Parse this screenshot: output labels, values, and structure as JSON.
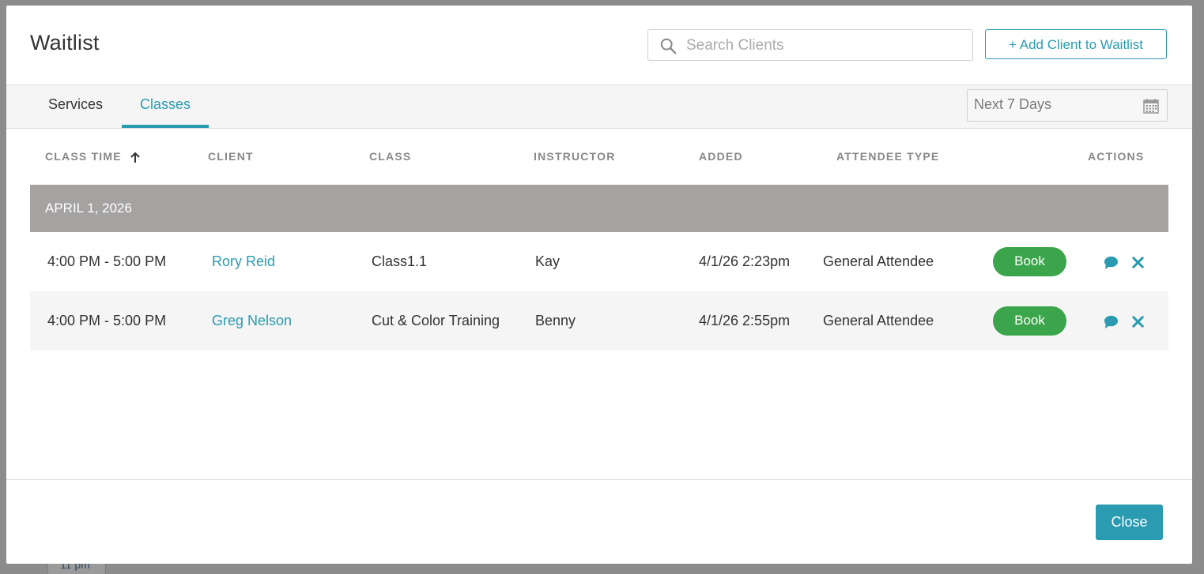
{
  "background": {
    "time_label": "11 pm"
  },
  "modal": {
    "title": "Waitlist",
    "search_placeholder": "Search Clients",
    "add_button": "+ Add Client to Waitlist",
    "tabs": [
      {
        "label": "Services",
        "active": false
      },
      {
        "label": "Classes",
        "active": true
      }
    ],
    "date_range": "Next 7 Days",
    "columns": [
      "CLASS TIME",
      "CLIENT",
      "CLASS",
      "INSTRUCTOR",
      "ADDED",
      "ATTENDEE TYPE",
      "ACTIONS"
    ],
    "sort_icon": "arrow-up-icon",
    "groups": [
      {
        "date": "APRIL 1, 2026",
        "rows": [
          {
            "time": "4:00 PM - 5:00 PM",
            "client": "Rory Reid",
            "class": "Class1.1",
            "instructor": "Kay",
            "added": "4/1/26 2:23pm",
            "attendee_type": "General Attendee",
            "book_label": "Book"
          },
          {
            "time": "4:00 PM - 5:00 PM",
            "client": "Greg Nelson",
            "class": "Cut & Color Training",
            "instructor": "Benny",
            "added": "4/1/26 2:55pm",
            "attendee_type": "General Attendee",
            "book_label": "Book"
          }
        ]
      }
    ],
    "close_button": "Close"
  },
  "colors": {
    "accent": "#2a9bb0",
    "book_green": "#3aa54a",
    "group_header": "#a5a2a2"
  }
}
